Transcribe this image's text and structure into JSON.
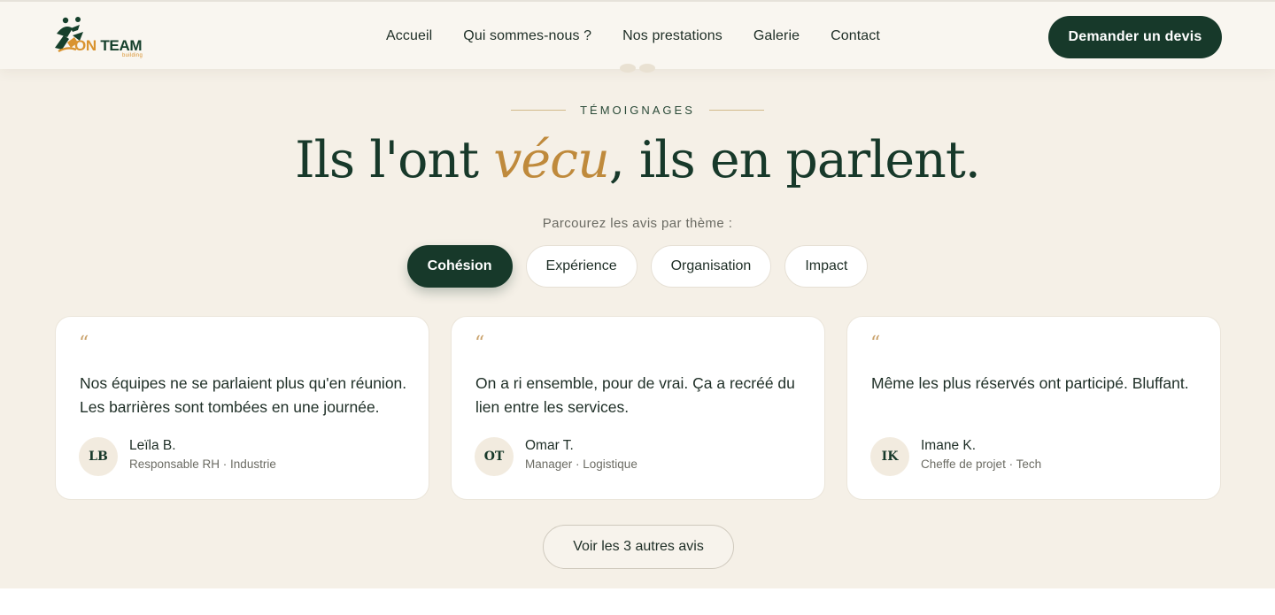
{
  "header": {
    "logo": {
      "on": "ON",
      "team": " TEAM",
      "sub": "building"
    },
    "nav": [
      "Accueil",
      "Qui sommes-nous ?",
      "Nos prestations",
      "Galerie",
      "Contact"
    ],
    "cta": "Demander un devis"
  },
  "section": {
    "eyebrow": "TÉMOIGNAGES",
    "title_part1": "Ils l'ont ",
    "title_accent": "vécu",
    "title_part2": ", ils en parlent.",
    "filter_label": "Parcourez les avis par thème :",
    "filters": [
      {
        "label": "Cohésion",
        "active": true
      },
      {
        "label": "Expérience",
        "active": false
      },
      {
        "label": "Organisation",
        "active": false
      },
      {
        "label": "Impact",
        "active": false
      }
    ]
  },
  "testimonials": [
    {
      "quote_mark": "“",
      "text": "Nos équipes ne se parlaient plus qu'en réunion. Les barrières sont tombées en une journée.",
      "initials": "LB",
      "name": "Leïla B.",
      "role": "Responsable RH · Industrie"
    },
    {
      "quote_mark": "“",
      "text": "On a ri ensemble, pour de vrai. Ça a recréé du lien entre les services.",
      "initials": "OT",
      "name": "Omar T.",
      "role": "Manager · Logistique"
    },
    {
      "quote_mark": "“",
      "text": "Même les plus réservés ont participé. Bluffant.",
      "initials": "IK",
      "name": "Imane K.",
      "role": "Cheffe de projet · Tech"
    }
  ],
  "more_button": "Voir les 3 autres avis",
  "colors": {
    "primary": "#17392a",
    "accent": "#bf8a3c",
    "background": "#f5f0e7"
  },
  "icons": [
    "team-logo-icon",
    "quote-icon"
  ]
}
